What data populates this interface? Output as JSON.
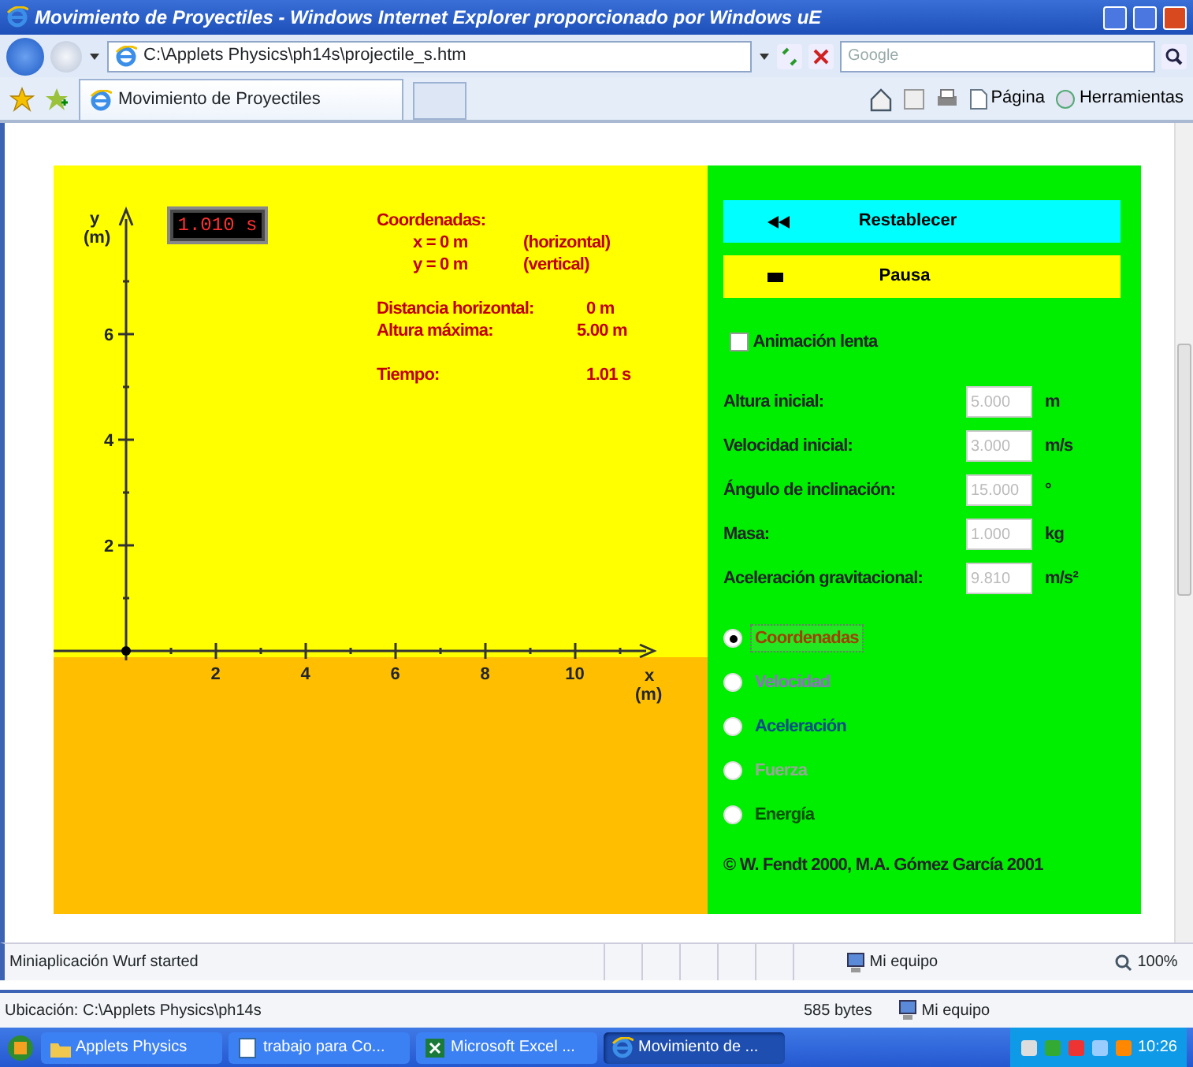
{
  "window": {
    "title": "Movimiento de Proyectiles - Windows Internet Explorer proporcionado por Windows uE"
  },
  "address_bar": {
    "url": "C:\\Applets Physics\\ph14s\\projectile_s.htm"
  },
  "search": {
    "placeholder": "Google"
  },
  "tabs": [
    {
      "label": "Movimiento de Proyectiles",
      "selected": true
    }
  ],
  "command_bar": [
    {
      "label": "Página",
      "kind": "page"
    },
    {
      "label": "Herramientas",
      "kind": "tools"
    }
  ],
  "applet": {
    "timer": "1.010 s",
    "coordinates": {
      "heading": "Coordenadas:",
      "rows": [
        {
          "value": "x = 0 m",
          "note": "(horizontal)"
        },
        {
          "value": "y = 0 m",
          "note": "(vertical)"
        }
      ]
    },
    "results": [
      {
        "label": "Distancia horizontal:",
        "value": "0 m"
      },
      {
        "label": "Altura máxima:",
        "value": "5.00 m"
      },
      {
        "label": "Tiempo:",
        "value": "1.01 s"
      }
    ],
    "plot": {
      "y_label": "y",
      "y_unit": "(m)",
      "x_label": "x",
      "x_unit": "(m)",
      "x_ticks": [
        "2",
        "4",
        "6",
        "8",
        "10"
      ],
      "y_ticks": [
        "6",
        "4",
        "2"
      ]
    },
    "buttons": [
      {
        "kind": "reset",
        "label": "Restablecer"
      },
      {
        "kind": "pause",
        "label": "Pausa"
      }
    ],
    "slow_motion": {
      "label": "Animación lenta",
      "checked": false
    },
    "parameters": [
      {
        "label": "Altura inicial:",
        "value": "5.000",
        "unit": "m",
        "disabled": true
      },
      {
        "label": "Velocidad inicial:",
        "value": "3.000",
        "unit": "m/s",
        "disabled": true
      },
      {
        "label": "Ángulo de inclinación:",
        "value": "15.000",
        "unit": "°",
        "disabled": true
      },
      {
        "label": "Masa:",
        "value": "1.000",
        "unit": "kg",
        "disabled": true
      },
      {
        "label": "Aceleración gravitacional:",
        "value": "9.810",
        "unit": "m/s²",
        "disabled": true
      }
    ],
    "display_options": [
      {
        "label": "Coordenadas",
        "selected": true,
        "color": "#a04000"
      },
      {
        "label": "Velocidad",
        "selected": false,
        "color": "#9a6acb"
      },
      {
        "label": "Aceleración",
        "selected": false,
        "color": "#004a8a"
      },
      {
        "label": "Fuerza",
        "selected": false,
        "color": "#9aa69a"
      },
      {
        "label": "Energía",
        "selected": false,
        "color": "#004d00"
      }
    ],
    "copyright": "© W. Fendt 2000, M.A. Gómez García 2001"
  },
  "status_bar": {
    "text": "Miniaplicación Wurf started",
    "zone": "Mi equipo",
    "zoom": "100%"
  },
  "info_bar": {
    "location": "Ubicación: C:\\Applets Physics\\ph14s",
    "size": "585 bytes",
    "zone": "Mi equipo"
  },
  "taskbar": {
    "items": [
      {
        "label": "Applets Physics",
        "kind": "folder",
        "selected": false
      },
      {
        "label": "trabajo para Co...",
        "kind": "doc",
        "selected": false
      },
      {
        "label": "Microsoft Excel ...",
        "kind": "excel",
        "selected": false
      },
      {
        "label": "Movimiento de ...",
        "kind": "ie",
        "selected": true
      }
    ],
    "clock": "10:26"
  }
}
